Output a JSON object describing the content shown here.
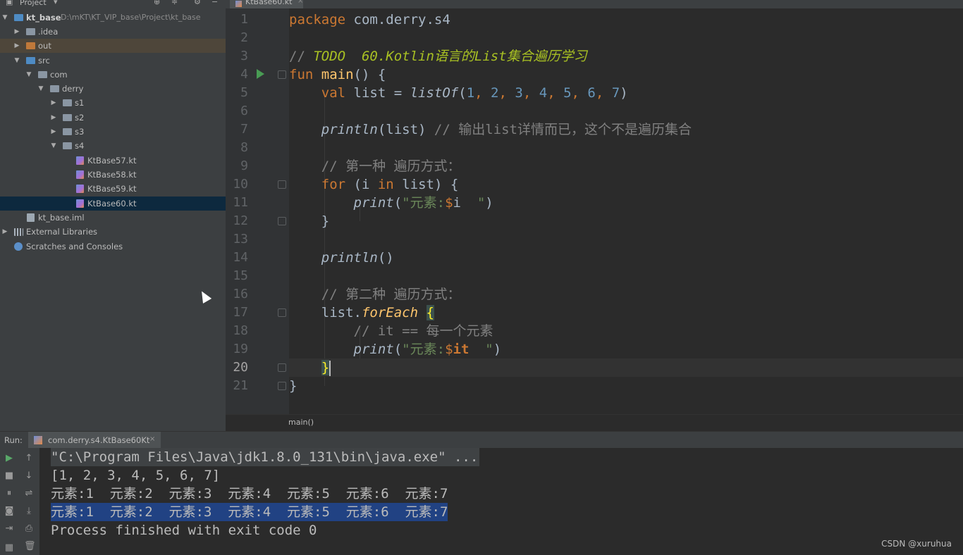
{
  "project": {
    "header_label": "Project",
    "tree": [
      {
        "label": "kt_base",
        "path": "D:\\mKT\\KT_VIP_base\\Project\\kt_base",
        "icon": "module-folder-icon",
        "expanded": true
      },
      {
        "label": ".idea",
        "icon": "folder-icon",
        "expanded": false
      },
      {
        "label": "out",
        "icon": "folder-orange-icon",
        "expanded": false
      },
      {
        "label": "src",
        "icon": "source-folder-icon",
        "expanded": true
      },
      {
        "label": "com",
        "icon": "package-icon",
        "expanded": true
      },
      {
        "label": "derry",
        "icon": "package-icon",
        "expanded": true
      },
      {
        "label": "s1",
        "icon": "package-icon",
        "expanded": false
      },
      {
        "label": "s2",
        "icon": "package-icon",
        "expanded": false
      },
      {
        "label": "s3",
        "icon": "package-icon",
        "expanded": false
      },
      {
        "label": "s4",
        "icon": "package-icon",
        "expanded": true
      },
      {
        "label": "KtBase57.kt",
        "icon": "kotlin-file-icon"
      },
      {
        "label": "KtBase58.kt",
        "icon": "kotlin-file-icon"
      },
      {
        "label": "KtBase59.kt",
        "icon": "kotlin-file-icon"
      },
      {
        "label": "KtBase60.kt",
        "icon": "kotlin-file-icon",
        "selected": true
      },
      {
        "label": "kt_base.iml",
        "icon": "iml-file-icon"
      },
      {
        "label": "External Libraries",
        "icon": "library-icon",
        "expanded": false
      },
      {
        "label": "Scratches and Consoles",
        "icon": "scratch-icon"
      }
    ]
  },
  "editor": {
    "tab_label": "KtBase60.kt",
    "current_line": 20,
    "line_numbers": [
      "1",
      "2",
      "3",
      "4",
      "5",
      "6",
      "7",
      "8",
      "9",
      "10",
      "11",
      "12",
      "13",
      "14",
      "15",
      "16",
      "17",
      "18",
      "19",
      "20",
      "21"
    ],
    "code": {
      "l1_kw": "package",
      "l1_rest": " com.derry.s4",
      "l3_comment": "// ",
      "l3_todo": "TODO  60.Kotlin语言的List集合遍历学习",
      "l4_kw": "fun",
      "l4_fn": "main",
      "l4_rest": "() {",
      "l5_kw": "val",
      "l5_a": " list = ",
      "l5_fn": "listOf",
      "l5_open": "(",
      "l5_nums": [
        "1",
        "2",
        "3",
        "4",
        "5",
        "6",
        "7"
      ],
      "l5_close": ")",
      "l7_fn": "println",
      "l7_args": "(list) ",
      "l7_comment": "// 输出list详情而已，这个不是遍历集合",
      "l9_comment": "// 第一种 遍历方式：",
      "l10_for": "for",
      "l10_a": " (i ",
      "l10_in": "in",
      "l10_b": " list) {",
      "l11_fn": "print",
      "l11_open": "(",
      "l11_str1": "\"元素:",
      "l11_tpl": "$",
      "l11_var": "i",
      "l11_str2": "  \"",
      "l11_close": ")",
      "l12": "}",
      "l14_fn": "println",
      "l14_rest": "()",
      "l16_comment": "// 第二种 遍历方式：",
      "l17_a": "list.",
      "l17_ext": "forEach",
      "l17_space": " ",
      "l17_brace": "{",
      "l18_comment": "// it == 每一个元素",
      "l19_fn": "print",
      "l19_open": "(",
      "l19_str1": "\"元素:",
      "l19_tpl": "$",
      "l19_var": "it",
      "l19_str2": "  \"",
      "l19_close": ")",
      "l20_brace": "}",
      "l21": "}"
    },
    "breadcrumb": "main()"
  },
  "run": {
    "label": "Run:",
    "tab_label": "com.derry.s4.KtBase60Kt",
    "console": [
      "\"C:\\Program Files\\Java\\jdk1.8.0_131\\bin\\java.exe\" ...",
      "[1, 2, 3, 4, 5, 6, 7]",
      "元素:1  元素:2  元素:3  元素:4  元素:5  元素:6  元素:7",
      "元素:1  元素:2  元素:3  元素:4  元素:5  元素:6  元素:7",
      "Process finished with exit code 0"
    ]
  },
  "watermark": "CSDN @xuruhua",
  "colors": {
    "keyword": "#cc7832",
    "function": "#ffc66d",
    "number": "#6897bb",
    "string": "#6a8759",
    "comment": "#808080",
    "todo": "#a8c023",
    "selection": "#214283"
  }
}
